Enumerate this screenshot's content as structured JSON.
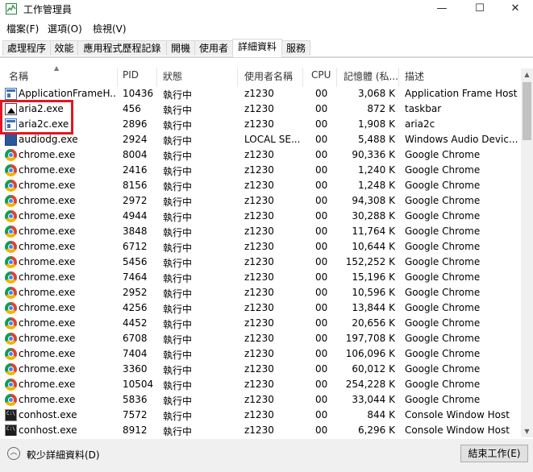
{
  "window": {
    "title": "工作管理員",
    "minimize_glyph": "—",
    "maximize_glyph": "☐",
    "close_glyph": "✕"
  },
  "menu": [
    "檔案(F)",
    "選項(O)",
    "檢視(V)"
  ],
  "tabs": [
    "處理程序",
    "效能",
    "應用程式歷程記錄",
    "開機",
    "使用者",
    "詳細資料",
    "服務"
  ],
  "active_tab": "詳細資料",
  "columns": {
    "name": "名稱",
    "pid": "PID",
    "status": "狀態",
    "user": "使用者名稱",
    "cpu": "CPU",
    "memory": "記憶體 (私...",
    "description": "描述"
  },
  "rows": [
    {
      "icon": "window-app-icon",
      "name": "ApplicationFrameH...",
      "pid": "10436",
      "status": "執行中",
      "user": "z1230",
      "cpu": "00",
      "memory": "3,068 K",
      "description": "Application Frame Host"
    },
    {
      "icon": "aria2-icon",
      "name": "aria2.exe",
      "pid": "456",
      "status": "執行中",
      "user": "z1230",
      "cpu": "00",
      "memory": "872 K",
      "description": "taskbar"
    },
    {
      "icon": "window-app-icon",
      "name": "aria2c.exe",
      "pid": "2896",
      "status": "執行中",
      "user": "z1230",
      "cpu": "00",
      "memory": "1,908 K",
      "description": "aria2c"
    },
    {
      "icon": "audio-icon",
      "name": "audiodg.exe",
      "pid": "2924",
      "status": "執行中",
      "user": "LOCAL SE...",
      "cpu": "00",
      "memory": "5,488 K",
      "description": "Windows Audio Devic..."
    },
    {
      "icon": "chrome-icon",
      "name": "chrome.exe",
      "pid": "8004",
      "status": "執行中",
      "user": "z1230",
      "cpu": "00",
      "memory": "90,336 K",
      "description": "Google Chrome"
    },
    {
      "icon": "chrome-icon",
      "name": "chrome.exe",
      "pid": "2416",
      "status": "執行中",
      "user": "z1230",
      "cpu": "00",
      "memory": "1,240 K",
      "description": "Google Chrome"
    },
    {
      "icon": "chrome-icon",
      "name": "chrome.exe",
      "pid": "8156",
      "status": "執行中",
      "user": "z1230",
      "cpu": "00",
      "memory": "1,248 K",
      "description": "Google Chrome"
    },
    {
      "icon": "chrome-icon",
      "name": "chrome.exe",
      "pid": "2972",
      "status": "執行中",
      "user": "z1230",
      "cpu": "00",
      "memory": "94,308 K",
      "description": "Google Chrome"
    },
    {
      "icon": "chrome-icon",
      "name": "chrome.exe",
      "pid": "4944",
      "status": "執行中",
      "user": "z1230",
      "cpu": "00",
      "memory": "30,288 K",
      "description": "Google Chrome"
    },
    {
      "icon": "chrome-icon",
      "name": "chrome.exe",
      "pid": "3848",
      "status": "執行中",
      "user": "z1230",
      "cpu": "00",
      "memory": "11,764 K",
      "description": "Google Chrome"
    },
    {
      "icon": "chrome-icon",
      "name": "chrome.exe",
      "pid": "6712",
      "status": "執行中",
      "user": "z1230",
      "cpu": "00",
      "memory": "10,644 K",
      "description": "Google Chrome"
    },
    {
      "icon": "chrome-icon",
      "name": "chrome.exe",
      "pid": "5456",
      "status": "執行中",
      "user": "z1230",
      "cpu": "00",
      "memory": "152,252 K",
      "description": "Google Chrome"
    },
    {
      "icon": "chrome-icon",
      "name": "chrome.exe",
      "pid": "7464",
      "status": "執行中",
      "user": "z1230",
      "cpu": "00",
      "memory": "15,196 K",
      "description": "Google Chrome"
    },
    {
      "icon": "chrome-icon",
      "name": "chrome.exe",
      "pid": "2952",
      "status": "執行中",
      "user": "z1230",
      "cpu": "00",
      "memory": "10,596 K",
      "description": "Google Chrome"
    },
    {
      "icon": "chrome-icon",
      "name": "chrome.exe",
      "pid": "4256",
      "status": "執行中",
      "user": "z1230",
      "cpu": "00",
      "memory": "13,844 K",
      "description": "Google Chrome"
    },
    {
      "icon": "chrome-icon",
      "name": "chrome.exe",
      "pid": "4452",
      "status": "執行中",
      "user": "z1230",
      "cpu": "00",
      "memory": "20,656 K",
      "description": "Google Chrome"
    },
    {
      "icon": "chrome-icon",
      "name": "chrome.exe",
      "pid": "6708",
      "status": "執行中",
      "user": "z1230",
      "cpu": "00",
      "memory": "197,708 K",
      "description": "Google Chrome"
    },
    {
      "icon": "chrome-icon",
      "name": "chrome.exe",
      "pid": "7404",
      "status": "執行中",
      "user": "z1230",
      "cpu": "00",
      "memory": "106,096 K",
      "description": "Google Chrome"
    },
    {
      "icon": "chrome-icon",
      "name": "chrome.exe",
      "pid": "3360",
      "status": "執行中",
      "user": "z1230",
      "cpu": "00",
      "memory": "60,012 K",
      "description": "Google Chrome"
    },
    {
      "icon": "chrome-icon",
      "name": "chrome.exe",
      "pid": "10504",
      "status": "執行中",
      "user": "z1230",
      "cpu": "00",
      "memory": "254,228 K",
      "description": "Google Chrome"
    },
    {
      "icon": "chrome-icon",
      "name": "chrome.exe",
      "pid": "5836",
      "status": "執行中",
      "user": "z1230",
      "cpu": "00",
      "memory": "33,044 K",
      "description": "Google Chrome"
    },
    {
      "icon": "console-icon",
      "name": "conhost.exe",
      "pid": "7572",
      "status": "執行中",
      "user": "z1230",
      "cpu": "00",
      "memory": "844 K",
      "description": "Console Window Host"
    },
    {
      "icon": "console-icon",
      "name": "conhost.exe",
      "pid": "8912",
      "status": "執行中",
      "user": "z1230",
      "cpu": "00",
      "memory": "6,296 K",
      "description": "Console Window Host"
    }
  ],
  "footer": {
    "fewer_details": "較少詳細資料(D)",
    "end_task": "結束工作(E)"
  },
  "colors": {
    "highlight": "#e0181f",
    "tab_border": "#d9d9d9",
    "footer_bg": "#f0f0f0"
  }
}
